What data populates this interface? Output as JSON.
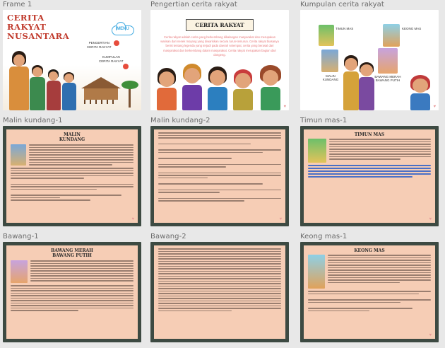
{
  "frames": [
    {
      "label": "Frame 1",
      "type": "cover",
      "title_lines": [
        "CERITA",
        "RAKYAT",
        "NUSANTARA"
      ],
      "menu_label": "MENU",
      "link1": [
        "PENGERTIAN",
        "CERITA RAKYAT"
      ],
      "link2": [
        "KUMPULAN",
        "CERITA RAKYAT"
      ]
    },
    {
      "label": "Pengertian cerita rakyat",
      "type": "definition",
      "heading": "CERITA RAKYAT",
      "body": "Cerita rakyat adalah cerita yang berkembang dikalangan masyarakat dan merupakan warisan dari nenek moyang yang diwariskan secara turun-temurun. Cerita rakyat biasanya berisi tentang legenda yang terjadi pada daerah setempat, cerita yang berasal dari masyarakat dan berkembang dalam masyarakat. Cerita rakyat merupakan bagian dari dongeng."
    },
    {
      "label": "Kumpulan cerita rakyat",
      "type": "collection",
      "books": [
        "TIMUN MAS",
        "KEONG MAS",
        "MALIN KUNDANG",
        "BAWANG MERAH BAWANG PUTIH"
      ]
    },
    {
      "label": "Malin kundang-1",
      "type": "story",
      "heading": "MALIN KUNDANG"
    },
    {
      "label": "Malin kundang-2",
      "type": "story2",
      "heading": ""
    },
    {
      "label": "Timun mas-1",
      "type": "story",
      "heading": "TIMUN MAS"
    },
    {
      "label": "Bawang-1",
      "type": "story",
      "heading": "BAWANG MERAH BAWANG PUTIH"
    },
    {
      "label": "Bawang-2",
      "type": "story2",
      "heading": ""
    },
    {
      "label": "Keong mas-1",
      "type": "story",
      "heading": "KEONG MAS"
    }
  ],
  "colors": {
    "canvas": "#e8e8e8",
    "paper": "#f6cdb5",
    "frame_border": "#3d4a42",
    "title_red": "#c0392b",
    "cloud_blue": "#3fa9e0",
    "highlight_blue": "#3866c8"
  }
}
